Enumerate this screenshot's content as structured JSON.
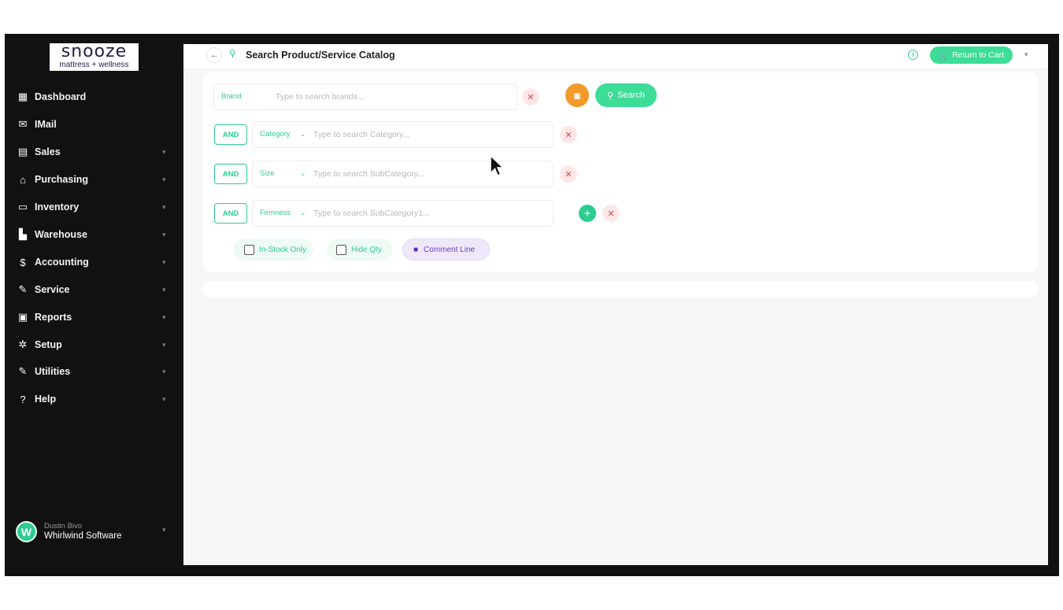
{
  "logo": {
    "brand": "snooze",
    "tagline": "mattress + wellness"
  },
  "sidebar": {
    "items": [
      {
        "label": "Dashboard",
        "icon": "dashboard-icon",
        "glyph": "▦",
        "has_children": false
      },
      {
        "label": "IMail",
        "icon": "mail-icon",
        "glyph": "✉",
        "has_children": false
      },
      {
        "label": "Sales",
        "icon": "sales-icon",
        "glyph": "▤",
        "has_children": true
      },
      {
        "label": "Purchasing",
        "icon": "bag-icon",
        "glyph": "⌂",
        "has_children": true
      },
      {
        "label": "Inventory",
        "icon": "inventory-icon",
        "glyph": "▭",
        "has_children": true
      },
      {
        "label": "Warehouse",
        "icon": "warehouse-icon",
        "glyph": "▙",
        "has_children": true
      },
      {
        "label": "Accounting",
        "icon": "dollar-icon",
        "glyph": "$",
        "has_children": true
      },
      {
        "label": "Service",
        "icon": "wrench-icon",
        "glyph": "✎",
        "has_children": true
      },
      {
        "label": "Reports",
        "icon": "reports-icon",
        "glyph": "▣",
        "has_children": true
      },
      {
        "label": "Setup",
        "icon": "gear-icon",
        "glyph": "✲",
        "has_children": true
      },
      {
        "label": "Utilities",
        "icon": "wrench-icon",
        "glyph": "✎",
        "has_children": true
      },
      {
        "label": "Help",
        "icon": "help-icon",
        "glyph": "?",
        "has_children": true
      }
    ],
    "user": {
      "initial": "W",
      "name": "Dustin Bivo",
      "company": "Whirlwind Software"
    }
  },
  "header": {
    "title": "Search Product/Service Catalog",
    "return_label": "Return to Cart"
  },
  "search": {
    "brand": {
      "label": "Brand",
      "placeholder": "Type to search brands..."
    },
    "search_label": "Search",
    "filters": [
      {
        "connector": "AND",
        "label": "Category",
        "placeholder": "Type to search Category..."
      },
      {
        "connector": "AND",
        "label": "Size",
        "placeholder": "Type to search SubCategory..."
      },
      {
        "connector": "AND",
        "label": "Firmness",
        "placeholder": "Type to search SubCategory1..."
      }
    ],
    "options": {
      "in_stock_only": "In-Stock Only",
      "hide_qty": "Hide Qty",
      "comment_line": "Comment Line"
    }
  },
  "colors": {
    "accent": "#2ecc8f",
    "sidebar_bg": "#111111",
    "camera": "#f39a2a",
    "comment_chip": "#6b3fbf",
    "clear": "#d24a4a"
  }
}
